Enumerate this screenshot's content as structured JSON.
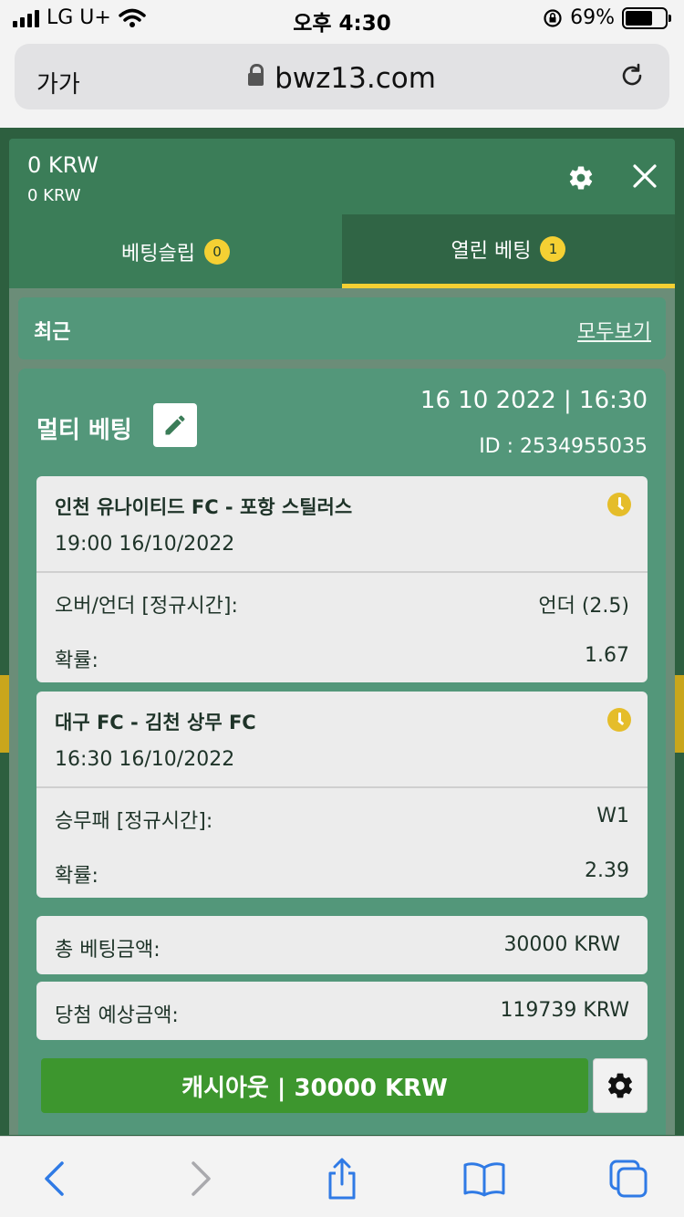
{
  "status_bar": {
    "carrier": "LG U+",
    "time": "오후 4:30",
    "battery": "69%",
    "battery_level": 0.69
  },
  "browser": {
    "aa_label": "가가",
    "url": "bwz13.com"
  },
  "header": {
    "balance_main": "0 KRW",
    "balance_sub": "0 KRW"
  },
  "tabs": [
    {
      "label": "베팅슬립",
      "badge": "0",
      "active": false
    },
    {
      "label": "열린 베팅",
      "badge": "1",
      "active": true
    }
  ],
  "recent": {
    "label": "최근",
    "view_all": "모두보기"
  },
  "bet": {
    "title": "멀티 베팅",
    "datetime": "16 10 2022 | 16:30",
    "id": "ID : 2534955035",
    "matches": [
      {
        "name": "인천 유나이티드 FC - 포항 스틸러스",
        "time": "19:00   16/10/2022",
        "market_label": "오버/언더 [정규시간]:",
        "market_value": "언더 (2.5)",
        "odds_label": "확률:",
        "odds_value": "1.67"
      },
      {
        "name": "대구 FC - 김천 상무 FC",
        "time": "16:30   16/10/2022",
        "market_label": "승무패 [정규시간]:",
        "market_value": "W1",
        "odds_label": "확률:",
        "odds_value": "2.39"
      }
    ],
    "total_label": "총 베팅금액:",
    "total_value": "30000 KRW",
    "payout_label": "당첨 예상금액:",
    "payout_value": "119739 KRW",
    "cashout_label": "캐시아웃 | 30000 KRW"
  },
  "colors": {
    "header_green": "#3b7d58",
    "card_green": "#53977a",
    "accent_yellow": "#f5d033",
    "cashout_green": "#3d962e",
    "ios_blue": "#2f7ae5"
  }
}
